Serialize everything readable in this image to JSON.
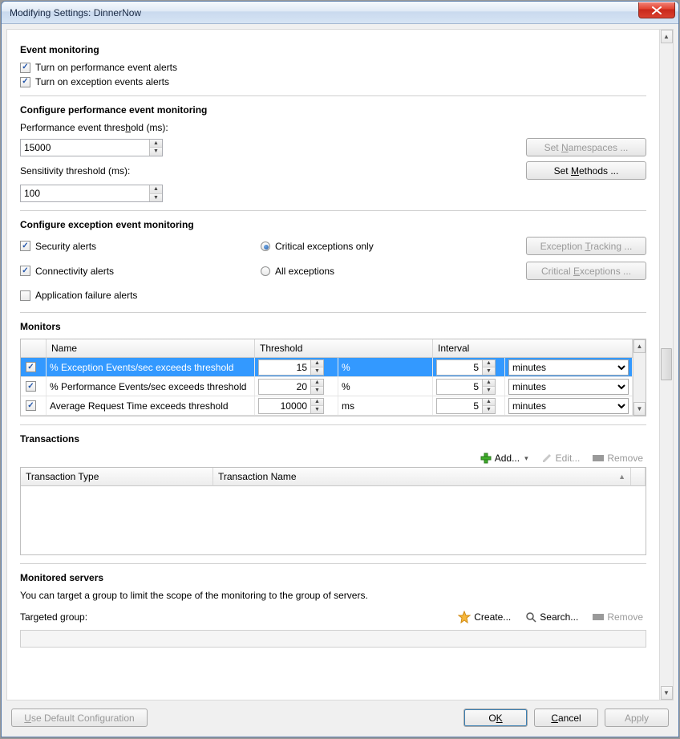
{
  "window_title": "Modifying Settings: DinnerNow",
  "event_monitoring": {
    "heading": "Event monitoring",
    "perf_alerts_label": "Turn on performance event alerts",
    "perf_alerts_checked": true,
    "excp_alerts_label": "Turn on exception events alerts",
    "excp_alerts_checked": true
  },
  "perf_config": {
    "heading": "Configure performance event monitoring",
    "threshold_label_pre": "Performance event thres",
    "threshold_label_u": "h",
    "threshold_label_post": "old (ms):",
    "threshold_value": "15000",
    "sensitivity_label": "Sensitivity threshold (ms):",
    "sensitivity_value": "100",
    "set_namespaces_pre": "Set ",
    "set_namespaces_u": "N",
    "set_namespaces_post": "amespaces ...",
    "set_methods_pre": "Set ",
    "set_methods_u": "M",
    "set_methods_post": "ethods ..."
  },
  "excp_config": {
    "heading": "Configure exception event monitoring",
    "security_label": "Security alerts",
    "security_checked": true,
    "connectivity_label": "Connectivity alerts",
    "connectivity_checked": true,
    "appfail_label": "Application failure alerts",
    "appfail_checked": false,
    "critical_label": "Critical exceptions only",
    "critical_selected": true,
    "all_label": "All exceptions",
    "btn_tracking_pre": "Exception ",
    "btn_tracking_u": "T",
    "btn_tracking_post": "racking ...",
    "btn_critical_pre": "Critical ",
    "btn_critical_u": "E",
    "btn_critical_post": "xceptions ..."
  },
  "monitors": {
    "heading": "Monitors",
    "columns": {
      "c1": "",
      "c2": "Name",
      "c3": "Threshold",
      "c5": "Interval"
    },
    "rows": [
      {
        "checked": true,
        "name": "% Exception Events/sec exceeds threshold",
        "threshold": "15",
        "unit": "%",
        "interval": "5",
        "interval_unit": "minutes",
        "selected": true
      },
      {
        "checked": true,
        "name": "% Performance Events/sec exceeds threshold",
        "threshold": "20",
        "unit": "%",
        "interval": "5",
        "interval_unit": "minutes",
        "selected": false
      },
      {
        "checked": true,
        "name": "Average Request Time exceeds threshold",
        "threshold": "10000",
        "unit": "ms",
        "interval": "5",
        "interval_unit": "minutes",
        "selected": false
      }
    ]
  },
  "transactions": {
    "heading": "Transactions",
    "add_label": "Add...",
    "edit_label": "Edit...",
    "remove_label": "Remove",
    "col_type": "Transaction Type",
    "col_name": "Transaction Name"
  },
  "servers": {
    "heading": "Monitored servers",
    "desc": "You can target a group to limit the scope of the monitoring to the group of servers.",
    "targeted_label": "Targeted group:",
    "create_label": "Create...",
    "search_label": "Search...",
    "remove_label": "Remove"
  },
  "buttons": {
    "use_default_pre": "",
    "use_default_u": "U",
    "use_default_post": "se Default Configuration",
    "ok_pre": "O",
    "ok_u": "K",
    "ok_post": "",
    "cancel_u": "C",
    "cancel_post": "ancel",
    "apply_label": "Apply"
  }
}
